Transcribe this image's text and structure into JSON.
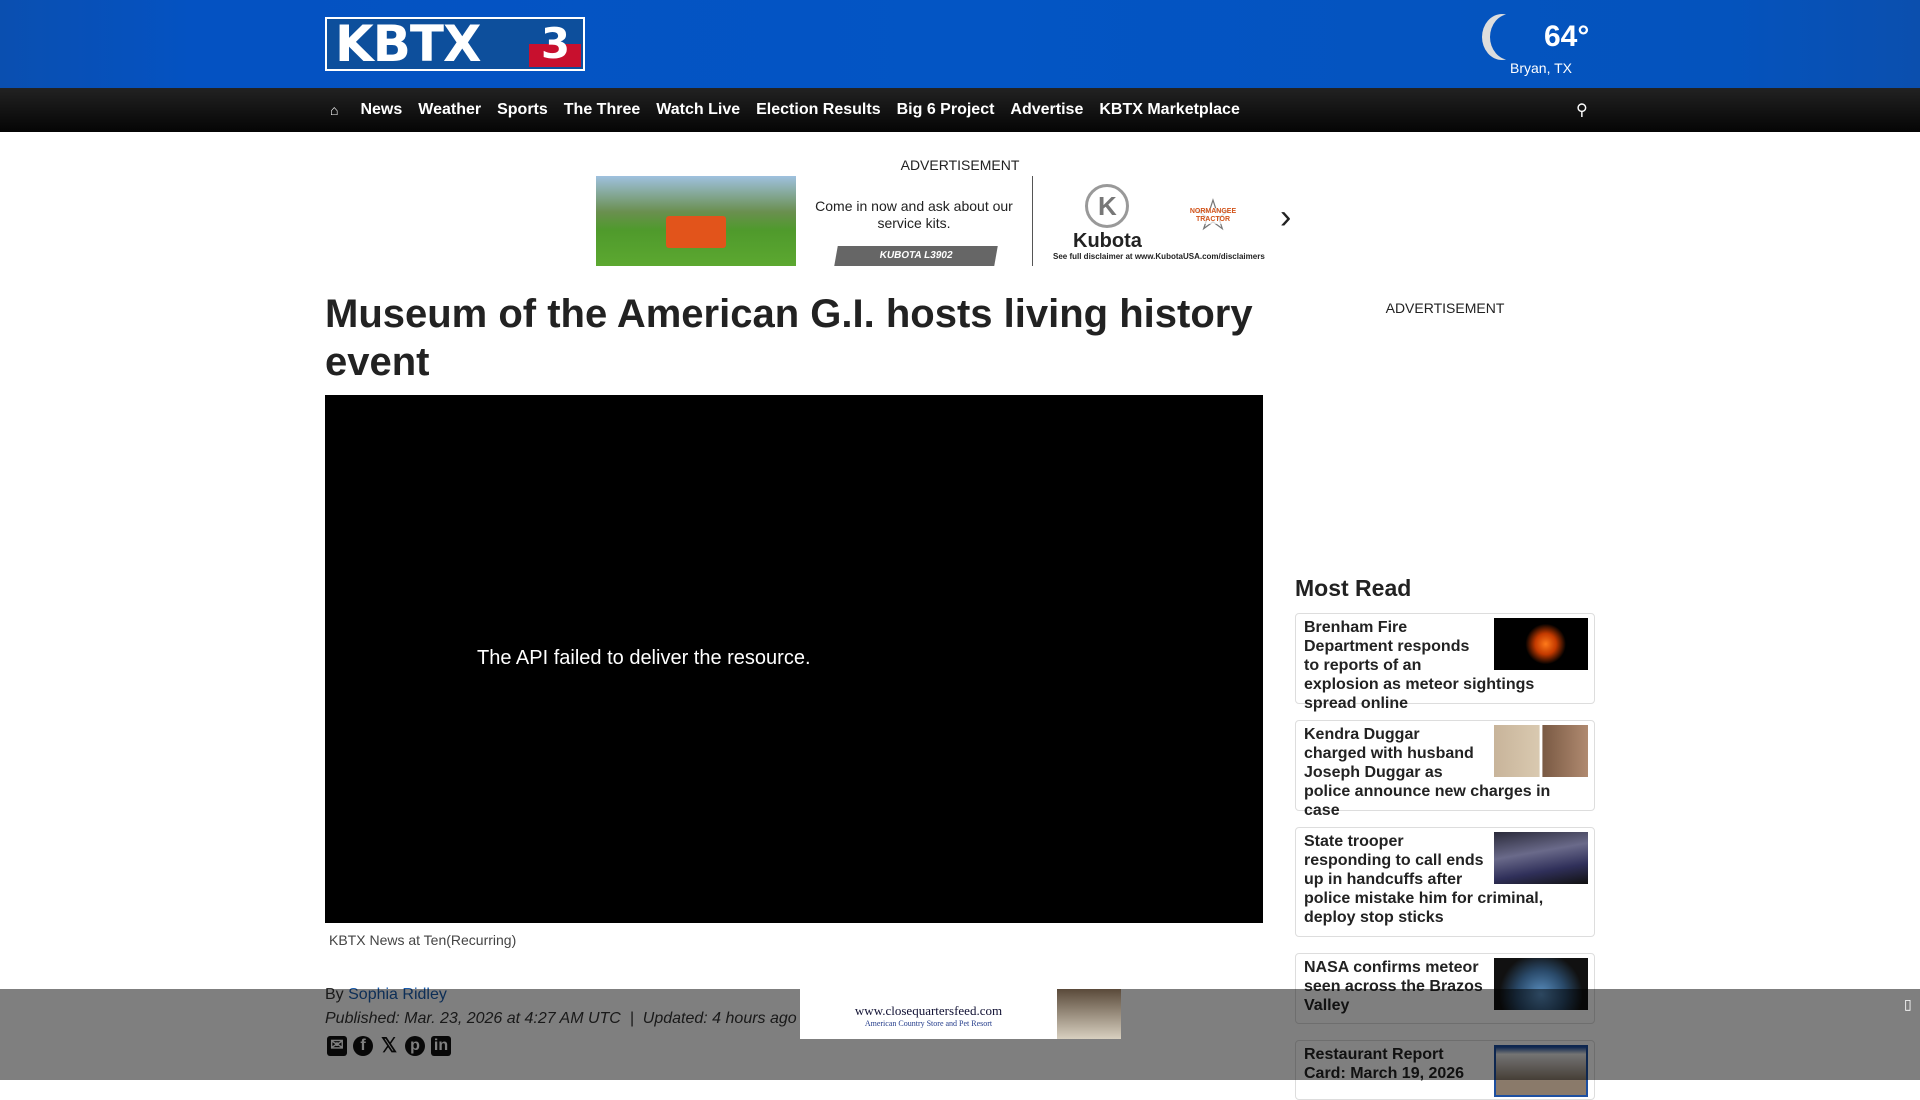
{
  "header": {
    "logo": "KBTX3",
    "weather": {
      "temp": "64°",
      "location": "Bryan, TX",
      "icon": "moon-cloud-icon"
    }
  },
  "nav": {
    "items": [
      "News",
      "Weather",
      "Sports",
      "The Three",
      "Watch Live",
      "Election Results",
      "Big 6 Project",
      "Advertise",
      "KBTX Marketplace"
    ]
  },
  "ad": {
    "label": "ADVERTISEMENT",
    "text": "Come in now and ask about our service kits.",
    "cta": "KUBOTA L3902",
    "brand": "Kubota",
    "dealer": "NORMANGEE TRACTOR",
    "disclaimer": "See full disclaimer at www.KubotaUSA.com/disclaimers"
  },
  "article": {
    "title": "Museum of the American G.I. hosts living history event",
    "video_error": "The API failed to deliver the resource.",
    "caption": "KBTX News at Ten(Recurring)",
    "by": "By",
    "author": "Sophia Ridley",
    "published": "Published: Mar. 23, 2026 at 4:27 AM UTC",
    "separator": "|",
    "updated": "Updated: 4 hours ago"
  },
  "sidebar": {
    "ad_label": "ADVERTISEMENT",
    "most_read": "Most Read",
    "items": [
      {
        "title": "Brenham Fire Department responds to reports of an explosion as meteor sightings spread online"
      },
      {
        "title": "Kendra Duggar charged with husband Joseph Duggar as police announce new charges in case"
      },
      {
        "title": "State trooper responding to call ends up in handcuffs after police mistake him for criminal, deploy stop sticks"
      },
      {
        "title": "NASA confirms meteor seen across the Brazos Valley"
      },
      {
        "title": "Restaurant Report Card: March 19, 2026"
      }
    ]
  },
  "sticky_ad": {
    "url": "www.closequartersfeed.com",
    "store": "American Country Store and Pet Resort"
  }
}
